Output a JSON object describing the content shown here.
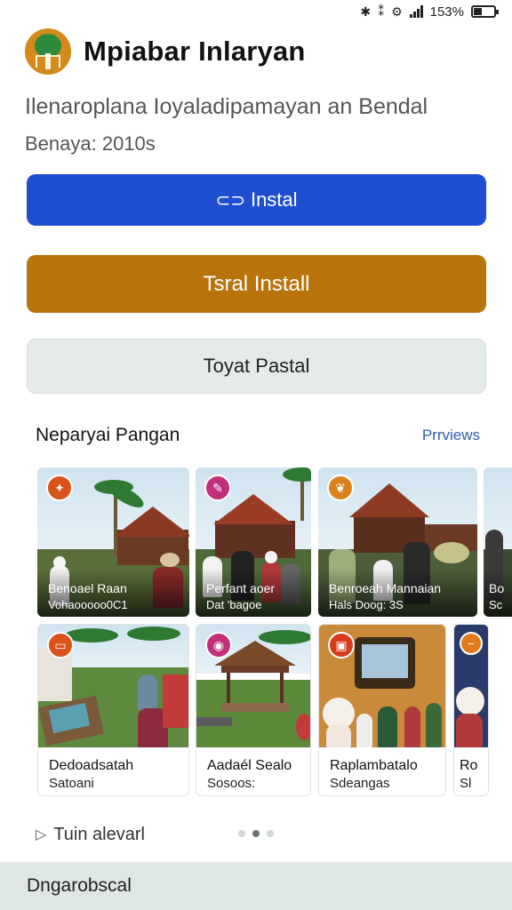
{
  "status": {
    "battery_text": "153%",
    "icons": [
      "bluetooth-icon",
      "vibrate-icon",
      "signal-icon",
      "battery-icon"
    ]
  },
  "app": {
    "title": "Mpiabar Inlaryan",
    "subtitle": "Ilenaroplana Ioyaladipamayan an Bendal",
    "meta": "Benaya: 2010s"
  },
  "buttons": {
    "primary": "Instal",
    "primary_icon": "link-icon",
    "secondary": "Tsral Install",
    "tertiary": "Toyat Pastal"
  },
  "section": {
    "title": "Neparyai Pangan",
    "link": "Prrviews"
  },
  "cards_top": [
    {
      "title": "Benoael Raan",
      "sub": "Vohaooooo0C1",
      "badge_color": "#d9531a",
      "badge_icon": "gift-icon"
    },
    {
      "title": "Perfant aoer",
      "sub": "Dat 'bagoe",
      "badge_color": "#c2307a",
      "badge_icon": "chat-icon"
    },
    {
      "title": "Benroeah Mannaian",
      "sub": "Hals Doog: 3S",
      "badge_color": "#d9831a",
      "badge_icon": "leaf-icon"
    },
    {
      "title": "Bo",
      "sub": "Sc"
    }
  ],
  "cards_bottom": [
    {
      "title": "Dedoadsatah",
      "sub": "Satoani",
      "badge_color": "#d9531a",
      "badge_icon": "tag-icon"
    },
    {
      "title": "Aadaél Sealo",
      "sub": "Sosoos:",
      "badge_color": "#c2307a",
      "badge_icon": "pin-icon"
    },
    {
      "title": "Raplambatalo",
      "sub": "Sdeangas",
      "badge_color": "#d93a1a",
      "badge_icon": "frame-icon"
    },
    {
      "title": "Ro",
      "sub": "Sl"
    }
  ],
  "footer": {
    "label": "Tuin alevarl",
    "icon": "play-icon",
    "pages": 3,
    "active_page": 2
  },
  "bottom_bar": {
    "label": "Dngarobscal"
  },
  "colors": {
    "primary": "#1f4fd1",
    "secondary": "#b8730c",
    "tertiary": "#e4ebe8",
    "link": "#2a5cb0"
  }
}
